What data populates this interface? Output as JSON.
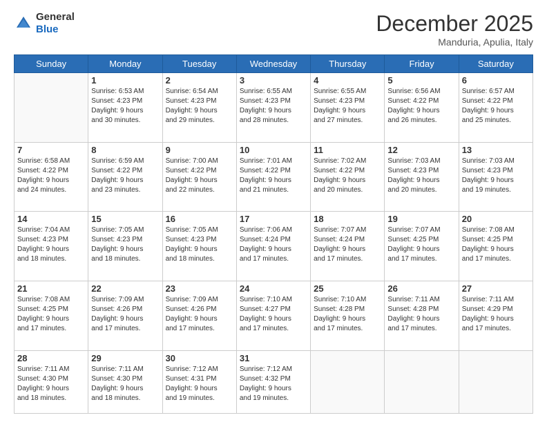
{
  "header": {
    "logo_general": "General",
    "logo_blue": "Blue",
    "month_title": "December 2025",
    "location": "Manduria, Apulia, Italy"
  },
  "days_of_week": [
    "Sunday",
    "Monday",
    "Tuesday",
    "Wednesday",
    "Thursday",
    "Friday",
    "Saturday"
  ],
  "weeks": [
    [
      {
        "day": "",
        "info": ""
      },
      {
        "day": "1",
        "info": "Sunrise: 6:53 AM\nSunset: 4:23 PM\nDaylight: 9 hours\nand 30 minutes."
      },
      {
        "day": "2",
        "info": "Sunrise: 6:54 AM\nSunset: 4:23 PM\nDaylight: 9 hours\nand 29 minutes."
      },
      {
        "day": "3",
        "info": "Sunrise: 6:55 AM\nSunset: 4:23 PM\nDaylight: 9 hours\nand 28 minutes."
      },
      {
        "day": "4",
        "info": "Sunrise: 6:55 AM\nSunset: 4:23 PM\nDaylight: 9 hours\nand 27 minutes."
      },
      {
        "day": "5",
        "info": "Sunrise: 6:56 AM\nSunset: 4:22 PM\nDaylight: 9 hours\nand 26 minutes."
      },
      {
        "day": "6",
        "info": "Sunrise: 6:57 AM\nSunset: 4:22 PM\nDaylight: 9 hours\nand 25 minutes."
      }
    ],
    [
      {
        "day": "7",
        "info": "Sunrise: 6:58 AM\nSunset: 4:22 PM\nDaylight: 9 hours\nand 24 minutes."
      },
      {
        "day": "8",
        "info": "Sunrise: 6:59 AM\nSunset: 4:22 PM\nDaylight: 9 hours\nand 23 minutes."
      },
      {
        "day": "9",
        "info": "Sunrise: 7:00 AM\nSunset: 4:22 PM\nDaylight: 9 hours\nand 22 minutes."
      },
      {
        "day": "10",
        "info": "Sunrise: 7:01 AM\nSunset: 4:22 PM\nDaylight: 9 hours\nand 21 minutes."
      },
      {
        "day": "11",
        "info": "Sunrise: 7:02 AM\nSunset: 4:22 PM\nDaylight: 9 hours\nand 20 minutes."
      },
      {
        "day": "12",
        "info": "Sunrise: 7:03 AM\nSunset: 4:23 PM\nDaylight: 9 hours\nand 20 minutes."
      },
      {
        "day": "13",
        "info": "Sunrise: 7:03 AM\nSunset: 4:23 PM\nDaylight: 9 hours\nand 19 minutes."
      }
    ],
    [
      {
        "day": "14",
        "info": "Sunrise: 7:04 AM\nSunset: 4:23 PM\nDaylight: 9 hours\nand 18 minutes."
      },
      {
        "day": "15",
        "info": "Sunrise: 7:05 AM\nSunset: 4:23 PM\nDaylight: 9 hours\nand 18 minutes."
      },
      {
        "day": "16",
        "info": "Sunrise: 7:05 AM\nSunset: 4:23 PM\nDaylight: 9 hours\nand 18 minutes."
      },
      {
        "day": "17",
        "info": "Sunrise: 7:06 AM\nSunset: 4:24 PM\nDaylight: 9 hours\nand 17 minutes."
      },
      {
        "day": "18",
        "info": "Sunrise: 7:07 AM\nSunset: 4:24 PM\nDaylight: 9 hours\nand 17 minutes."
      },
      {
        "day": "19",
        "info": "Sunrise: 7:07 AM\nSunset: 4:25 PM\nDaylight: 9 hours\nand 17 minutes."
      },
      {
        "day": "20",
        "info": "Sunrise: 7:08 AM\nSunset: 4:25 PM\nDaylight: 9 hours\nand 17 minutes."
      }
    ],
    [
      {
        "day": "21",
        "info": "Sunrise: 7:08 AM\nSunset: 4:25 PM\nDaylight: 9 hours\nand 17 minutes."
      },
      {
        "day": "22",
        "info": "Sunrise: 7:09 AM\nSunset: 4:26 PM\nDaylight: 9 hours\nand 17 minutes."
      },
      {
        "day": "23",
        "info": "Sunrise: 7:09 AM\nSunset: 4:26 PM\nDaylight: 9 hours\nand 17 minutes."
      },
      {
        "day": "24",
        "info": "Sunrise: 7:10 AM\nSunset: 4:27 PM\nDaylight: 9 hours\nand 17 minutes."
      },
      {
        "day": "25",
        "info": "Sunrise: 7:10 AM\nSunset: 4:28 PM\nDaylight: 9 hours\nand 17 minutes."
      },
      {
        "day": "26",
        "info": "Sunrise: 7:11 AM\nSunset: 4:28 PM\nDaylight: 9 hours\nand 17 minutes."
      },
      {
        "day": "27",
        "info": "Sunrise: 7:11 AM\nSunset: 4:29 PM\nDaylight: 9 hours\nand 17 minutes."
      }
    ],
    [
      {
        "day": "28",
        "info": "Sunrise: 7:11 AM\nSunset: 4:30 PM\nDaylight: 9 hours\nand 18 minutes."
      },
      {
        "day": "29",
        "info": "Sunrise: 7:11 AM\nSunset: 4:30 PM\nDaylight: 9 hours\nand 18 minutes."
      },
      {
        "day": "30",
        "info": "Sunrise: 7:12 AM\nSunset: 4:31 PM\nDaylight: 9 hours\nand 19 minutes."
      },
      {
        "day": "31",
        "info": "Sunrise: 7:12 AM\nSunset: 4:32 PM\nDaylight: 9 hours\nand 19 minutes."
      },
      {
        "day": "",
        "info": ""
      },
      {
        "day": "",
        "info": ""
      },
      {
        "day": "",
        "info": ""
      }
    ]
  ]
}
